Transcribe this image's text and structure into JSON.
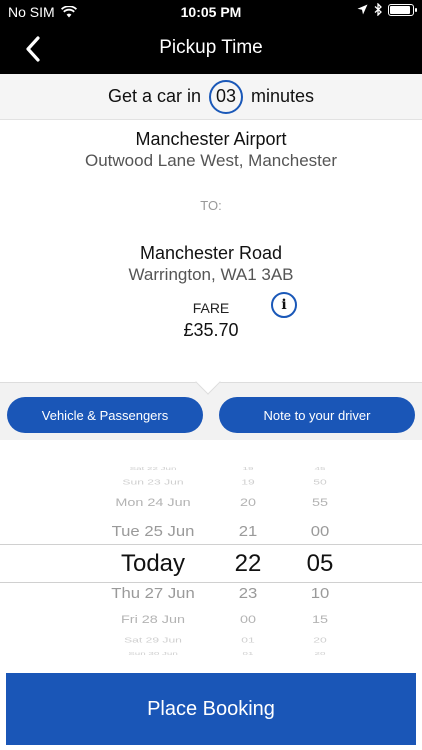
{
  "status_bar": {
    "carrier": "No SIM",
    "time": "10:05 PM",
    "battery_level": 0.9
  },
  "nav": {
    "title": "Pickup Time",
    "back_icon": "chevron-left-icon"
  },
  "eta": {
    "prefix": "Get a car in",
    "minutes": "03",
    "suffix": "minutes"
  },
  "pickup": {
    "name": "Manchester Airport",
    "address": "Outwood Lane West, Manchester"
  },
  "to_label": "TO:",
  "dropoff": {
    "name": "Manchester Road",
    "address": "Warrington, WA1 3AB"
  },
  "fare": {
    "label": "FARE",
    "value": "£35.70",
    "info_icon": "info-icon"
  },
  "options": {
    "vehicle_label": "Vehicle & Passengers",
    "note_label": "Note to your driver"
  },
  "picker": {
    "rows": [
      {
        "day": "Sat 22 Jun",
        "hour": "19",
        "minute": "45"
      },
      {
        "day": "Sun 23 Jun",
        "hour": "19",
        "minute": "50"
      },
      {
        "day": "Mon 24 Jun",
        "hour": "20",
        "minute": "55"
      },
      {
        "day": "Tue 25 Jun",
        "hour": "21",
        "minute": "00"
      },
      {
        "day": "Today",
        "hour": "22",
        "minute": "05"
      },
      {
        "day": "Thu 27 Jun",
        "hour": "23",
        "minute": "10"
      },
      {
        "day": "Fri 28 Jun",
        "hour": "00",
        "minute": "15"
      },
      {
        "day": "Sat 29 Jun",
        "hour": "01",
        "minute": "20"
      },
      {
        "day": "Sun 30 Jun",
        "hour": "01",
        "minute": "20"
      }
    ],
    "selected_index": 4
  },
  "place_booking_label": "Place Booking",
  "colors": {
    "brand_blue": "#1a56b7",
    "header_bg": "#000000"
  }
}
